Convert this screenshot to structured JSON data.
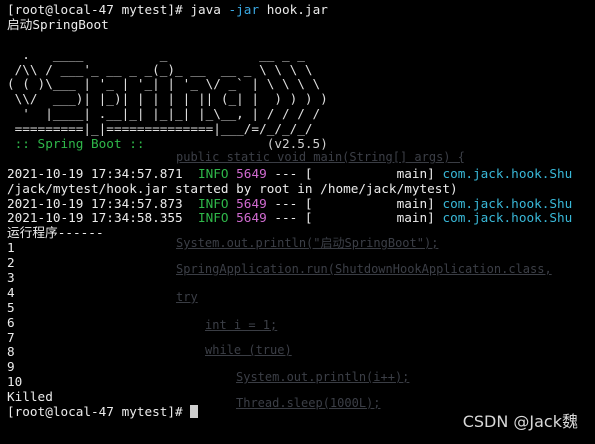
{
  "terminal": {
    "prompt": "[root@local-47 mytest]# ",
    "cmd_java": "java",
    "cmd_flag": "-jar",
    "cmd_arg": "hook.jar",
    "startup_message": "启动SpringBoot",
    "banner": [
      "  .   ____          _            __ _ _",
      " /\\\\ / ___'_ __ _ _(_)_ __  __ _ \\ \\ \\ \\",
      "( ( )\\___ | '_ | '_| | '_ \\/ _` | \\ \\ \\ \\",
      " \\\\/  ___)| |_)| | | | | || (_| |  ) ) ) )",
      "  '  |____| .__|_| |_|_| |_\\__, | / / / /",
      " =========|_|==============|___/=/_/_/_/"
    ],
    "spring_boot_label": " :: Spring Boot :: ",
    "spring_version": "(v2.5.5)",
    "log": [
      {
        "time": "2021-10-19 17:34:57.871",
        "level": "INFO",
        "pid": "5649",
        "sep": "--- [",
        "thread": "           main]",
        "logger": "com.jack.hook.Shu"
      },
      {
        "time": "2021-10-19 17:34:57.873",
        "level": "INFO",
        "pid": "5649",
        "sep": "--- [",
        "thread": "           main]",
        "logger": "com.jack.hook.Shu"
      },
      {
        "time": "2021-10-19 17:34:58.355",
        "level": "INFO",
        "pid": "5649",
        "sep": "--- [",
        "thread": "           main]",
        "logger": "com.jack.hook.Shu"
      }
    ],
    "started_line": "/jack/mytest/hook.jar started by root in /home/jack/mytest)",
    "run_message": "运行程序------",
    "counts": [
      "1",
      "2",
      "3",
      "4",
      "5",
      "6",
      "7",
      "8",
      "9",
      "10"
    ],
    "killed": "Killed",
    "final_prompt": "[root@local-47 mytest]# "
  },
  "watermark": "CSDN @Jack魏",
  "ghost_code": [
    "public static void main(String[] args) {",
    "System.out.println(\"启动SpringBoot\");",
    "SpringApplication.run(ShutdownHookApplication.class,",
    "try",
    "int i = 1;",
    "while (true)",
    "System.out.println(i++);",
    "Thread.sleep(1000L);"
  ],
  "colors": {
    "background": "#000000",
    "text": "#ececec",
    "green": "#2fb84a",
    "blue": "#3aa7e0",
    "magenta": "#d06bd0",
    "cyan": "#39b8d8"
  }
}
